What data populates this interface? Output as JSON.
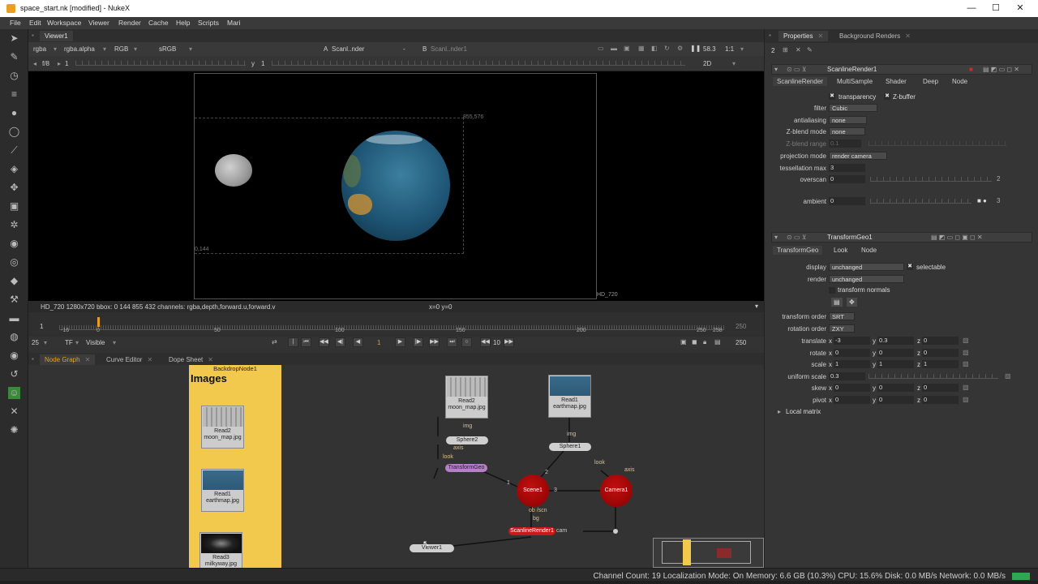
{
  "window": {
    "title": "space_start.nk [modified] - NukeX",
    "controls": [
      "—",
      "☐",
      "✕"
    ]
  },
  "menu": [
    "File",
    "Edit",
    "Workspace",
    "Viewer",
    "Render",
    "Cache",
    "Help",
    "Scripts",
    "Mari"
  ],
  "viewer": {
    "tab": "Viewer1",
    "channels": "rgba",
    "alpha": "rgba.alpha",
    "colorspace": "RGB",
    "lut": "sRGB",
    "input_a": "Scanl..nder",
    "input_a_letter": "A",
    "compare": "-",
    "input_b_letter": "B",
    "input_b": "Scanl..nder1",
    "zoom": "58.3",
    "ratio": "1:1",
    "view_mode": "2D",
    "fstop": "f/8",
    "frame_step": "1",
    "y_label": "y",
    "y_value": "1",
    "coord_topright": "855,576",
    "coord_bottomleft": "0,144",
    "format_label": "HD_720",
    "info": "HD_720 1280x720  bbox: 0 144 855 432 channels: rgba,depth,forward.u,forward.v",
    "cursor": "x=0 y=0"
  },
  "timeline": {
    "start": "1",
    "end": "250",
    "ticks": [
      "-16",
      "0",
      "50",
      "100",
      "150",
      "200",
      "250",
      "258"
    ],
    "fps": "25",
    "tf": "TF",
    "visible": "Visible",
    "current_frame": "1",
    "step": "10",
    "end_frame": "250"
  },
  "nodegraph_tabs": [
    "Node Graph",
    "Curve Editor",
    "Dope Sheet"
  ],
  "nodegraph": {
    "backdrop_name": "BackdropNode1",
    "backdrop_label": "Images",
    "read_nodes": [
      {
        "name": "Read2",
        "file": "moon_map.jpg"
      },
      {
        "name": "Read1",
        "file": "earthmap.jpg"
      },
      {
        "name": "Read3",
        "file": "milkyway.jpg"
      }
    ],
    "graph_read2": {
      "name": "Read2",
      "file": "moon_map.jpg"
    },
    "graph_read1": {
      "name": "Read1",
      "file": "earthmap.jpg"
    },
    "sphere2": "Sphere2",
    "sphere1": "Sphere1",
    "transformgeo": "TransformGeo",
    "scene": "Scene1",
    "camera": "Camera1",
    "scanline": "ScanlineRender1",
    "scanline_cam": "cam",
    "viewer_node": "Viewer1",
    "labels": {
      "img": "img",
      "axis": "axis",
      "look": "look",
      "obj_scn": "ob /scn",
      "bg": "bg",
      "n1": "1",
      "n2": "2",
      "n3": "3"
    }
  },
  "properties": {
    "tabs": [
      "Properties",
      "Background Renders"
    ],
    "count": "2",
    "scanline": {
      "name": "ScanlineRender1",
      "subtabs": [
        "ScanlineRender",
        "MultiSample",
        "Shader",
        "Deep",
        "Node"
      ],
      "transparency": "transparency",
      "zbuffer": "Z-buffer",
      "filter_label": "filter",
      "filter": "Cubic",
      "antialiasing_label": "antialiasing",
      "antialiasing": "none",
      "zblend_mode_label": "Z-blend mode",
      "zblend_mode": "none",
      "zblend_range_label": "Z-blend range",
      "zblend_range": "0.1",
      "projection_label": "projection mode",
      "projection": "render camera",
      "tess_label": "tessellation max",
      "tess": "3",
      "overscan_label": "overscan",
      "overscan": "0",
      "overscan_end": "2",
      "ambient_label": "ambient",
      "ambient": "0",
      "ambient_end": "3"
    },
    "transformgeo": {
      "name": "TransformGeo1",
      "subtabs": [
        "TransformGeo",
        "Look",
        "Node"
      ],
      "display_label": "display",
      "display": "unchanged",
      "selectable": "selectable",
      "render_label": "render",
      "render": "unchanged",
      "transform_normals": "transform normals",
      "order_label": "transform order",
      "order": "SRT",
      "rot_order_label": "rotation order",
      "rot_order": "ZXY",
      "translate_label": "translate",
      "tx": "-3",
      "ty": "0.3",
      "tz": "0",
      "rotate_label": "rotate",
      "rx": "0",
      "ry": "0",
      "rz": "0",
      "scale_label": "scale",
      "sx": "1",
      "sy": "1",
      "sz": "1",
      "uniform_label": "uniform scale",
      "uniform": "0.3",
      "skew_label": "skew",
      "kx": "0",
      "ky": "0",
      "kz": "0",
      "pivot_label": "pivot",
      "px": "0",
      "py": "0",
      "pz": "0",
      "local_matrix": "Local matrix",
      "axis_x": "x",
      "axis_y": "y",
      "axis_z": "z"
    }
  },
  "status": "Channel Count: 19  Localization Mode: On  Memory: 6.6 GB (10.3%)  CPU: 15.6%  Disk: 0.0 MB/s  Network: 0.0 MB/s"
}
